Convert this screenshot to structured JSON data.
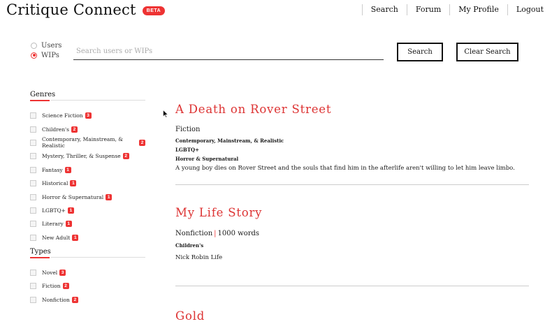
{
  "header": {
    "brand": "Critique Connect",
    "badge": "BETA",
    "nav": [
      "Search",
      "Forum",
      "My Profile",
      "Logout"
    ]
  },
  "search": {
    "radios": [
      {
        "label": "Users",
        "checked": false
      },
      {
        "label": "WIPs",
        "checked": true
      }
    ],
    "placeholder": "Search users or WIPs",
    "value": "",
    "search_label": "Search",
    "clear_label": "Clear Search"
  },
  "sidebar": {
    "genres": {
      "title": "Genres",
      "items": [
        {
          "label": "Science Fiction",
          "count": "3"
        },
        {
          "label": "Children's",
          "count": "2"
        },
        {
          "label": "Contemporary, Mainstream, & Realistic",
          "count": "2"
        },
        {
          "label": "Mystery, Thriller, & Suspense",
          "count": "2"
        },
        {
          "label": "Fantasy",
          "count": "1"
        },
        {
          "label": "Historical",
          "count": "1"
        },
        {
          "label": "Horror & Supernatural",
          "count": "1"
        },
        {
          "label": "LGBTQ+",
          "count": "1"
        },
        {
          "label": "Literary",
          "count": "1"
        },
        {
          "label": "New Adult",
          "count": "1"
        }
      ]
    },
    "types": {
      "title": "Types",
      "items": [
        {
          "label": "Novel",
          "count": "3"
        },
        {
          "label": "Fiction",
          "count": "2"
        },
        {
          "label": "Nonfiction",
          "count": "2"
        }
      ]
    }
  },
  "results": [
    {
      "title": "A Death on Rover Street",
      "type": "Fiction",
      "genres": [
        "Contemporary, Mainstream, & Realistic",
        "LGBTQ+",
        "Horror & Supernatural"
      ],
      "description": "A young boy dies on Rover Street and the souls that find him in the afterlife aren't willing to let him leave limbo."
    },
    {
      "title": "My Life Story",
      "type": "Nonfiction",
      "separator": "|",
      "words": "1000 words",
      "genres": [
        "Children's"
      ],
      "description": "Nick Robin Life"
    },
    {
      "title": "Gold"
    }
  ],
  "colors": {
    "accent": "#e33333",
    "text": "#1a1a1a"
  }
}
